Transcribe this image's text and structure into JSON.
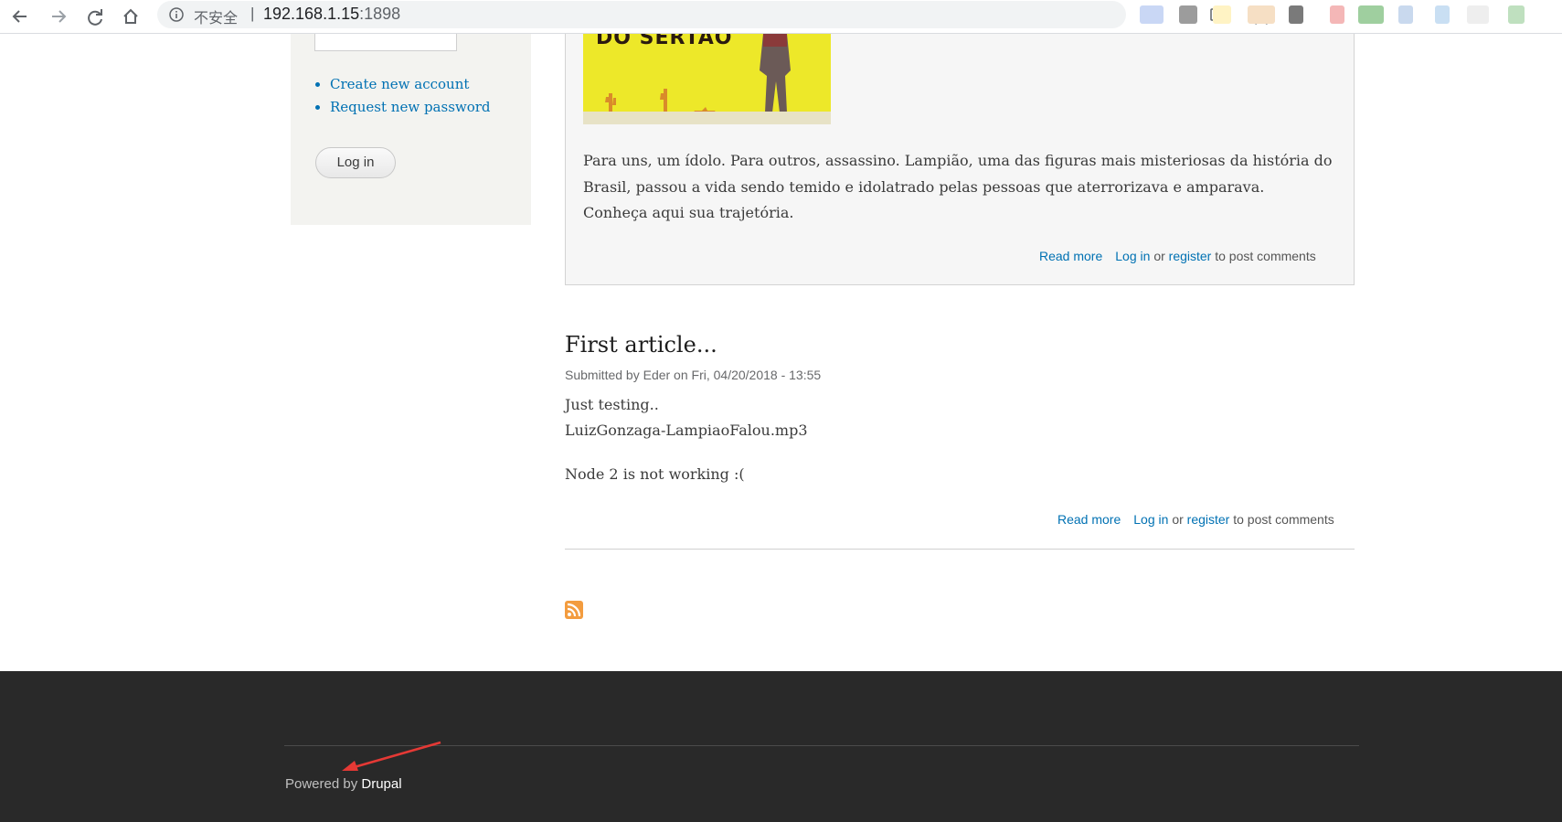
{
  "browser": {
    "security_label": "不安全",
    "separator": "|",
    "url_host": "192.168.1.15",
    "url_port": ":1898",
    "icons": [
      "back-icon",
      "forward-icon",
      "reload-icon",
      "home-icon",
      "info-icon",
      "translate-icon",
      "star-icon"
    ],
    "extension_colors": [
      "#c9d7f5",
      "#9c9c9c",
      "#fff3c4",
      "#f6dfc4",
      "#7a7a7a",
      "#f4b7b7",
      "#9fcf9f",
      "#c9d9ee",
      "#e8e8e8",
      "#bfe0bf"
    ]
  },
  "sidebar": {
    "links": [
      {
        "label": "Create new account"
      },
      {
        "label": "Request new password"
      }
    ],
    "login_button": "Log in"
  },
  "article1": {
    "image_title": "DO SERTÃO",
    "body": "Para uns, um ídolo. Para outros, assassino. Lampião, uma das figuras mais misteriosas da história do Brasil, passou a vida sendo temido e idolatrado pelas pessoas que aterrorizava e amparava. Conheça aqui sua trajetória.",
    "read_more": "Read more",
    "log_in": "Log in",
    "or": "or",
    "register": "register",
    "post_comments": "to post comments"
  },
  "article2": {
    "title": "First article...",
    "submitted": "Submitted by Eder on Fri, 04/20/2018 - 13:55",
    "body_line1": "Just testing..",
    "body_line2": "LuizGonzaga-LampiaoFalou.mp3",
    "body_line3": "Node 2 is not working :(",
    "read_more": "Read more",
    "log_in": "Log in",
    "or": "or",
    "register": "register",
    "post_comments": "to post comments"
  },
  "footer": {
    "powered_by": "Powered by",
    "drupal": "Drupal",
    "annotation_color": "#e53935"
  },
  "colors": {
    "link": "#0071b3",
    "footer_bg": "#292929",
    "rss": "#f39c3f"
  }
}
